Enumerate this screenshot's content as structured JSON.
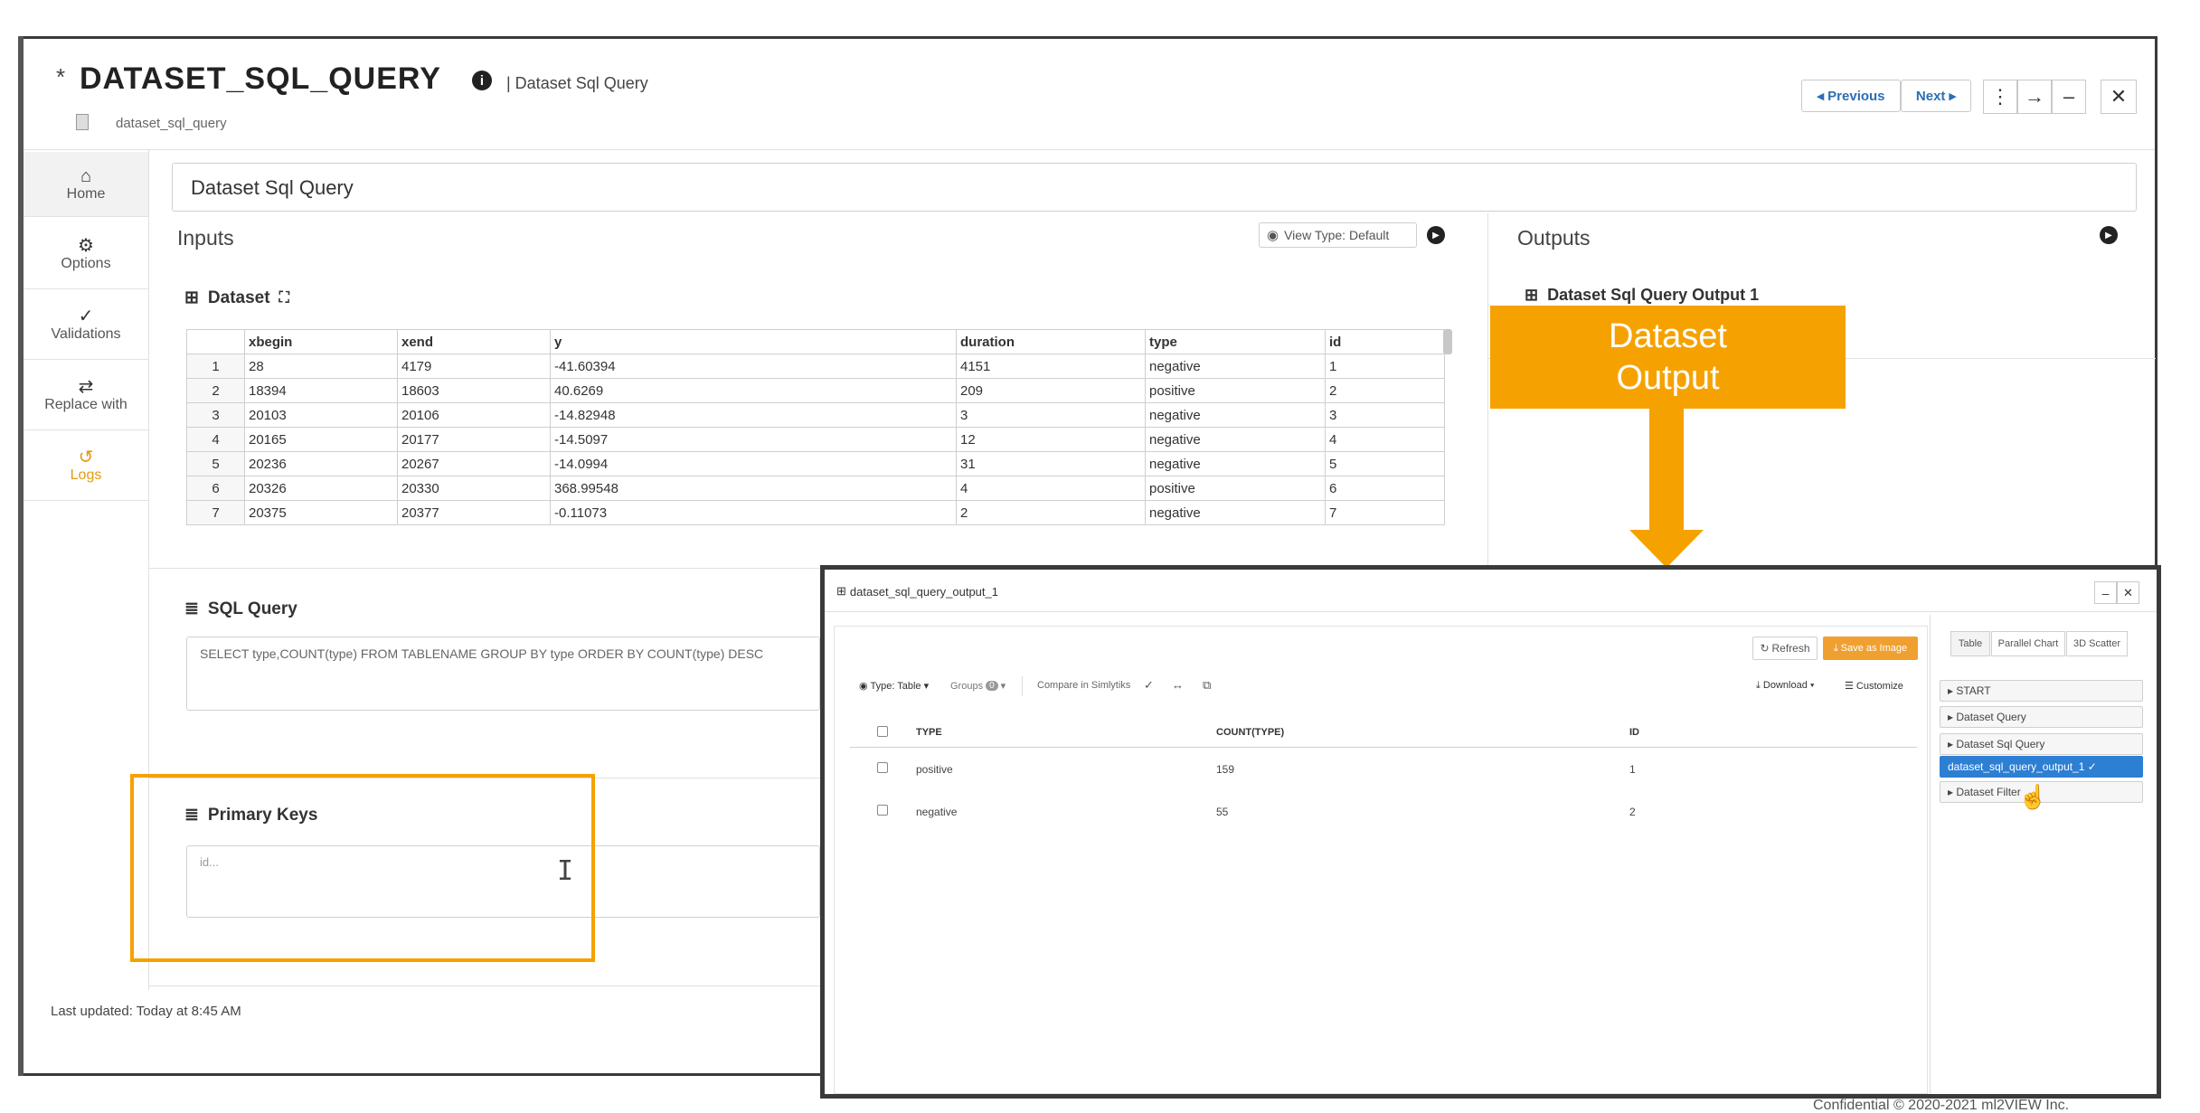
{
  "header": {
    "title": "DATASET_SQL_QUERY",
    "subtitle": "| Dataset Sql Query",
    "node_id": "dataset_sql_query",
    "prev_label": "◂ Previous",
    "next_label": "Next ▸"
  },
  "sidebar": {
    "items": [
      {
        "icon": "home-icon",
        "label": "Home"
      },
      {
        "icon": "gear-icon",
        "label": "Options"
      },
      {
        "icon": "check-icon",
        "label": "Validations"
      },
      {
        "icon": "swap-icon",
        "label": "Replace with"
      },
      {
        "icon": "history-icon",
        "label": "Logs"
      }
    ]
  },
  "name_field": {
    "value": "Dataset Sql Query"
  },
  "inputs": {
    "heading": "Inputs",
    "view_type": "View Type: Default",
    "dataset_label": "Dataset",
    "columns": [
      "xbegin",
      "xend",
      "y",
      "duration",
      "type",
      "id"
    ],
    "rows": [
      [
        "1",
        "28",
        "4179",
        "-41.60394",
        "4151",
        "negative",
        "1"
      ],
      [
        "2",
        "18394",
        "18603",
        "40.6269",
        "209",
        "positive",
        "2"
      ],
      [
        "3",
        "20103",
        "20106",
        "-14.82948",
        "3",
        "negative",
        "3"
      ],
      [
        "4",
        "20165",
        "20177",
        "-14.5097",
        "12",
        "negative",
        "4"
      ],
      [
        "5",
        "20236",
        "20267",
        "-14.0994",
        "31",
        "negative",
        "5"
      ],
      [
        "6",
        "20326",
        "20330",
        "368.99548",
        "4",
        "positive",
        "6"
      ],
      [
        "7",
        "20375",
        "20377",
        "-0.11073",
        "2",
        "negative",
        "7"
      ]
    ]
  },
  "outputs": {
    "heading": "Outputs",
    "dataset_label": "Dataset Sql Query Output 1"
  },
  "sql": {
    "label": "SQL Query",
    "query": "SELECT type,COUNT(type) FROM TABLENAME GROUP BY type ORDER BY COUNT(type) DESC"
  },
  "primary_keys": {
    "label": "Primary Keys",
    "placeholder": "id..."
  },
  "footer": {
    "last_updated": "Last updated: Today at 8:45 AM"
  },
  "callout": {
    "line1": "Dataset",
    "line2": "Output"
  },
  "colors": {
    "accent": "#f5a200",
    "logs": "#e39a11",
    "link": "#2a6fb5",
    "selected": "#2d7fd3"
  },
  "result_window": {
    "title": "dataset_sql_query_output_1",
    "refresh": "Refresh",
    "save_image": "Save as Image",
    "type_table": "Type: Table ▾",
    "groups": "Groups",
    "groups_count": "0",
    "compare": "Compare in Simlytiks",
    "download": "Download ▾",
    "customize": "Customize",
    "columns": [
      "TYPE",
      "COUNT(TYPE)",
      "ID"
    ],
    "rows": [
      [
        "positive",
        "159",
        "1"
      ],
      [
        "negative",
        "55",
        "2"
      ]
    ],
    "view_tabs": [
      "Table",
      "Parallel Chart",
      "3D Scatter"
    ],
    "tree": [
      "▸ START",
      "▸ Dataset Query",
      "▸ Dataset Sql Query",
      "dataset_sql_query_output_1 ✓",
      "▸ Dataset Filter"
    ]
  },
  "confidential": "Confidential © 2020-2021 ml2VIEW Inc."
}
